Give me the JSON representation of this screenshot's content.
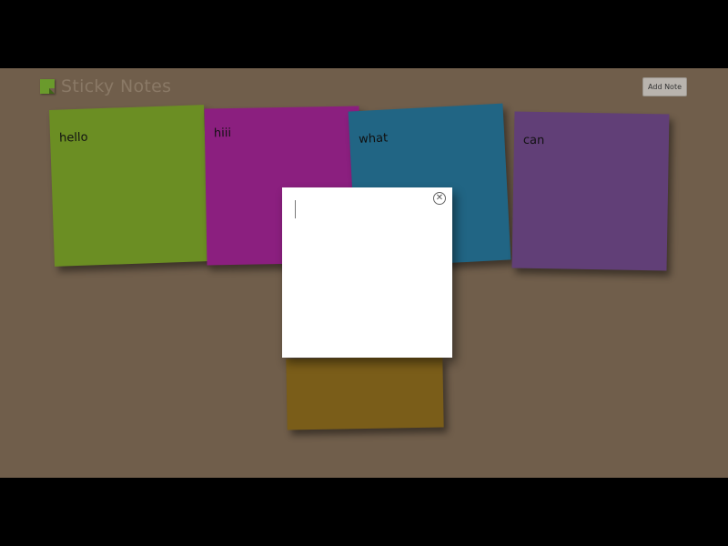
{
  "header": {
    "title": "Sticky Notes",
    "add_button_label": "Add Note"
  },
  "notes": [
    {
      "text": "hello",
      "color": "#6b8e23"
    },
    {
      "text": "hiii",
      "color": "#8b1f7f"
    },
    {
      "text": "what",
      "color": "#216584"
    },
    {
      "text": "can",
      "color": "#613f77"
    },
    {
      "text": "",
      "color": "#7a5d19"
    }
  ],
  "editor": {
    "value": "",
    "close_icon": "close-circle-icon"
  },
  "colors": {
    "background": "#705e4b",
    "editor_background": "#ffffff"
  }
}
